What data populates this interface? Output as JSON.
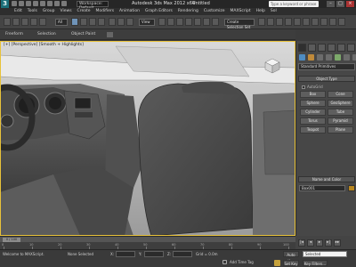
{
  "title_bar": {
    "logo": "3",
    "workspace": "Workspace: Default",
    "app_title": "Autodesk 3ds Max 2012 x64",
    "doc_title": "Untitled",
    "search_placeholder": "Type a keyword or phrase",
    "minimize": "–",
    "maximize": "□",
    "close": "×"
  },
  "menu": [
    "Edit",
    "Tools",
    "Group",
    "Views",
    "Create",
    "Modifiers",
    "Animation",
    "Graph Editors",
    "Rendering",
    "Customize",
    "MAXScript",
    "Help",
    "Sol"
  ],
  "toolbar": {
    "view_dropdown": "View",
    "selection_set": "Create Selection Set"
  },
  "ribbon": {
    "tabs": [
      "Freeform",
      "Selection",
      "Object Paint"
    ]
  },
  "viewport": {
    "label": "[+] [Perspective] [Smooth + Highlights]"
  },
  "command_panel": {
    "primitive_dropdown": "Standard Primitives",
    "object_type_header": "Object Type",
    "autogrid_label": "AutoGrid",
    "object_buttons": [
      "Box",
      "Cone",
      "Sphere",
      "GeoSphere",
      "Cylinder",
      "Tube",
      "Torus",
      "Pyramid",
      "Teapot",
      "Plane"
    ],
    "name_color_header": "Name and Color",
    "name_value": "Box001"
  },
  "time_slider": {
    "thumb": "0 / 100"
  },
  "ruler_ticks": [
    "0",
    "10",
    "20",
    "30",
    "40",
    "50",
    "60",
    "70",
    "80",
    "90",
    "100"
  ],
  "status": {
    "welcome": "Welcome to MAXScript.",
    "selection_info": "None Selected",
    "x_label": "X:",
    "y_label": "Y:",
    "z_label": "Z:",
    "grid": "Grid = 0.0m",
    "add_time_tag": "Add Time Tag",
    "auto_key": "Auto Key",
    "set_key": "Set Key",
    "key_filters": "Key Filters...",
    "selected_dropdown": "Selected"
  }
}
